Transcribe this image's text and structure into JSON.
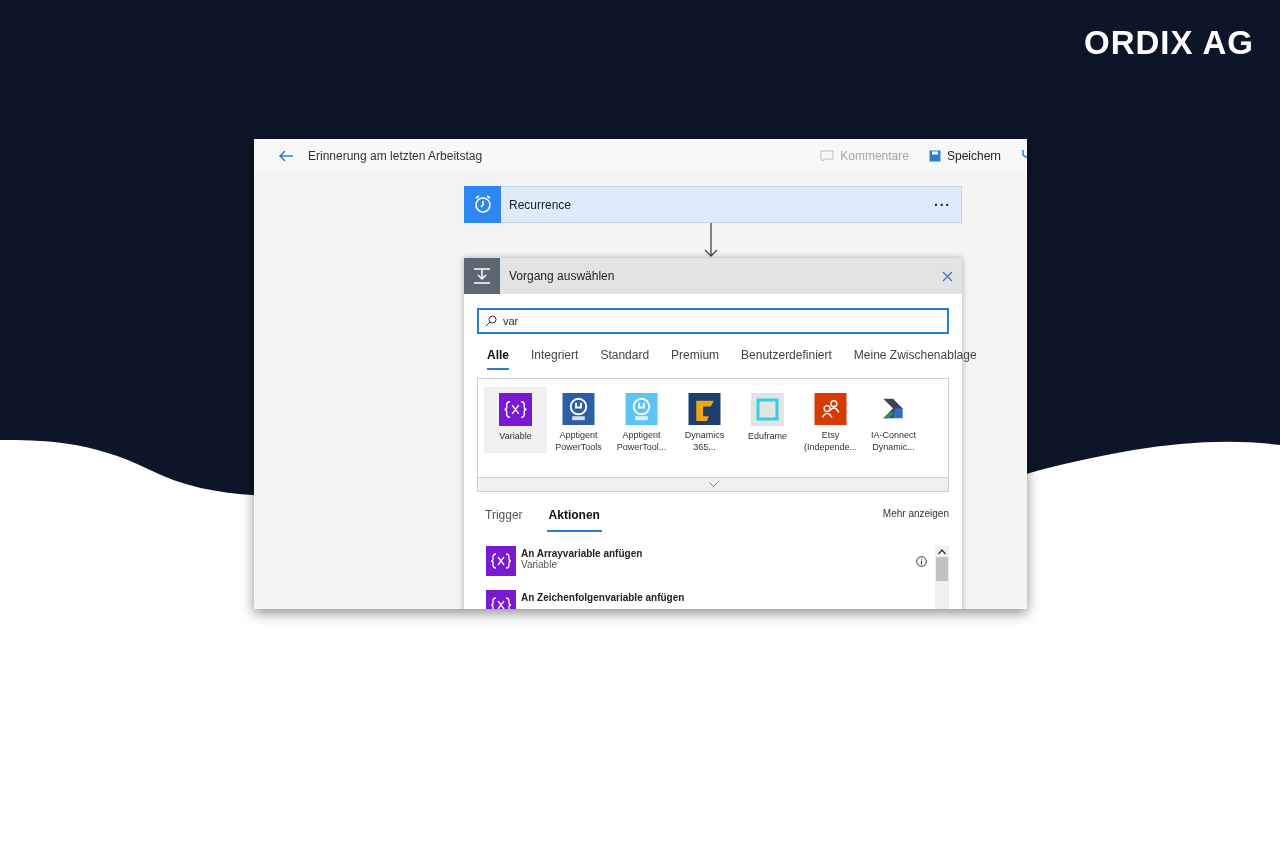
{
  "brand": "ORDIX AG",
  "window": {
    "title": "Erinnerung am letzten Arbeitstag",
    "actions": [
      {
        "label": "Kommentare",
        "disabled": true
      },
      {
        "label": "Speichern",
        "disabled": false
      }
    ]
  },
  "trigger_card": {
    "title": "Recurrence",
    "menu": "···"
  },
  "dialog": {
    "title": "Vorgang auswählen",
    "search": {
      "value": "var"
    },
    "tabs": [
      {
        "label": "Alle",
        "selected": true
      },
      {
        "label": "Integriert",
        "selected": false
      },
      {
        "label": "Standard",
        "selected": false
      },
      {
        "label": "Premium",
        "selected": false
      },
      {
        "label": "Benutzerdefiniert",
        "selected": false
      },
      {
        "label": "Meine Zwischenablage",
        "selected": false
      }
    ],
    "connectors": [
      {
        "label": "Variable",
        "kind": "variable",
        "color": "#7a19d4",
        "selected": true
      },
      {
        "label": "Apptigent PowerTools",
        "kind": "pro",
        "color": "#2f5ea8",
        "selected": false
      },
      {
        "label": "Apptigent PowerTool...",
        "kind": "lite",
        "color": "#5cc3f5",
        "selected": false
      },
      {
        "label": "Dynamics 365...",
        "kind": "dynamics",
        "color": "#1e3f6e",
        "selected": false
      },
      {
        "label": "Eduframe",
        "kind": "eduframe",
        "color": "#e3e3e3",
        "selected": false
      },
      {
        "label": "Etsy (Independe...",
        "kind": "etsy",
        "color": "#d83b01",
        "selected": false
      },
      {
        "label": "IA-Connect Dynamic...",
        "kind": "iaconnect",
        "color": "#3d4650",
        "selected": false
      }
    ],
    "subtabs": [
      {
        "label": "Trigger",
        "selected": false
      },
      {
        "label": "Aktionen",
        "selected": true
      }
    ],
    "more_link": "Mehr anzeigen",
    "actions": [
      {
        "title": "An Arrayvariable anfügen",
        "subtitle": "Variable",
        "info": true
      },
      {
        "title": "An Zeichenfolgenvariable anfügen",
        "info": false
      }
    ]
  }
}
